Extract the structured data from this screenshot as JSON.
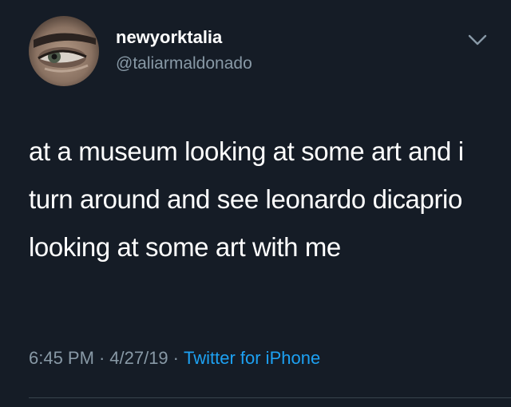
{
  "tweet": {
    "display_name": "newyorktalia",
    "handle": "@taliarmaldonado",
    "text": "at a museum looking at some art and i turn around and see leonardo dicaprio looking at some art with me",
    "time": "6:45 PM",
    "separator": "·",
    "date": "4/27/19",
    "source": "Twitter for iPhone"
  },
  "icons": {
    "avatar": "profile-photo-eye",
    "menu": "chevron-down-icon"
  },
  "colors": {
    "background": "#151c26",
    "primary_text": "#ffffff",
    "secondary_text": "#8899a6",
    "link": "#1da1f2",
    "divider": "#38444d"
  }
}
